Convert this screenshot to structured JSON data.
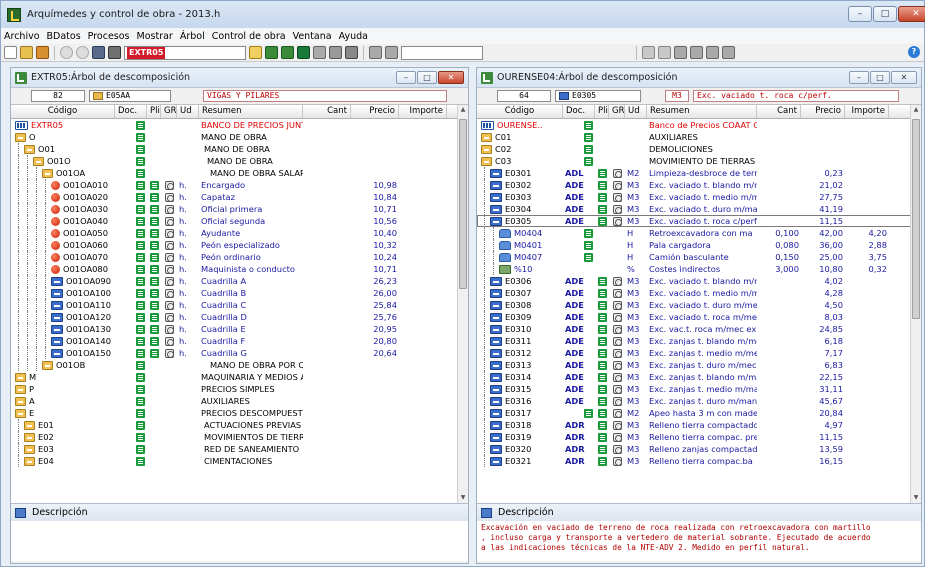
{
  "window": {
    "title": "Arquímedes y control de obra - 2013.h",
    "buttons": [
      "–",
      "□",
      "✕"
    ]
  },
  "menu": [
    "Archivo",
    "BDatos",
    "Procesos",
    "Mostrar",
    "Árbol",
    "Control de obra",
    "Ventana",
    "Ayuda"
  ],
  "toolbar": {
    "active_code": "EXTR05"
  },
  "left_panel": {
    "title": "EXTR05:Árbol de descomposición",
    "count": "82",
    "code": "E05AA",
    "name": "VIGAS Y PILARES",
    "columns": [
      "Código",
      "Doc.",
      "Pli",
      "GR",
      "Ud",
      "Resumen",
      "Cant",
      "Precio",
      "Importe"
    ],
    "rows": [
      {
        "icon": "root",
        "code": "EXTR05",
        "doc": true,
        "summary": "BANCO DE PRECIOS JUNTA",
        "style": "red",
        "indent": 0
      },
      {
        "icon": "chap",
        "code": "O",
        "doc": true,
        "summary": "MANO DE OBRA",
        "indent": 0
      },
      {
        "icon": "chap",
        "code": "O01",
        "doc": true,
        "summary": "MANO DE OBRA",
        "indent": 1
      },
      {
        "icon": "chap",
        "code": "O01O",
        "doc": true,
        "summary": "MANO DE OBRA",
        "indent": 2
      },
      {
        "icon": "chap",
        "code": "O01OA",
        "doc": true,
        "summary": "MANO DE OBRA SALAR",
        "indent": 3
      },
      {
        "icon": "basic",
        "code": "O01OA010",
        "doc": true,
        "pli": true,
        "ud": "h.",
        "summary": "Encargado",
        "price": "10,98",
        "indent": 4
      },
      {
        "icon": "basic",
        "code": "O01OA020",
        "doc": true,
        "pli": true,
        "ud": "h.",
        "summary": "Capataz",
        "price": "10,84",
        "indent": 4
      },
      {
        "icon": "basic",
        "code": "O01OA030",
        "doc": true,
        "pli": true,
        "ud": "h.",
        "summary": "Oficial primera",
        "price": "10,71",
        "indent": 4
      },
      {
        "icon": "basic",
        "code": "O01OA040",
        "doc": true,
        "pli": true,
        "ud": "h.",
        "summary": "Oficial segunda",
        "price": "10,56",
        "indent": 4
      },
      {
        "icon": "basic",
        "code": "O01OA050",
        "doc": true,
        "pli": true,
        "ud": "h.",
        "summary": "Ayudante",
        "price": "10,40",
        "indent": 4
      },
      {
        "icon": "basic",
        "code": "O01OA060",
        "doc": true,
        "pli": true,
        "ud": "h.",
        "summary": "Peón especializado",
        "price": "10,32",
        "indent": 4
      },
      {
        "icon": "basic",
        "code": "O01OA070",
        "doc": true,
        "pli": true,
        "ud": "h.",
        "summary": "Peón ordinario",
        "price": "10,24",
        "indent": 4
      },
      {
        "icon": "basic",
        "code": "O01OA080",
        "doc": true,
        "pli": true,
        "ud": "h.",
        "summary": "Maquinista o conducto",
        "price": "10,71",
        "indent": 4
      },
      {
        "icon": "dec",
        "code": "O01OA090",
        "doc": true,
        "pli": true,
        "ud": "h.",
        "summary": "Cuadrilla A",
        "price": "26,23",
        "indent": 4
      },
      {
        "icon": "dec",
        "code": "O01OA100",
        "doc": true,
        "pli": true,
        "ud": "h.",
        "summary": "Cuadrilla B",
        "price": "26,00",
        "indent": 4
      },
      {
        "icon": "dec",
        "code": "O01OA110",
        "doc": true,
        "pli": true,
        "ud": "h.",
        "summary": "Cuadrilla C",
        "price": "25,84",
        "indent": 4
      },
      {
        "icon": "dec",
        "code": "O01OA120",
        "doc": true,
        "pli": true,
        "ud": "h.",
        "summary": "Cuadrilla D",
        "price": "25,76",
        "indent": 4
      },
      {
        "icon": "dec",
        "code": "O01OA130",
        "doc": true,
        "pli": true,
        "ud": "h.",
        "summary": "Cuadrilla E",
        "price": "20,95",
        "indent": 4
      },
      {
        "icon": "dec",
        "code": "O01OA140",
        "doc": true,
        "pli": true,
        "ud": "h.",
        "summary": "Cuadrilla F",
        "price": "20,80",
        "indent": 4
      },
      {
        "icon": "dec",
        "code": "O01OA150",
        "doc": true,
        "pli": true,
        "ud": "h.",
        "summary": "Cuadrilla G",
        "price": "20,64",
        "indent": 4
      },
      {
        "icon": "chap",
        "code": "O01OB",
        "doc": true,
        "summary": "MANO DE OBRA POR C",
        "indent": 3
      },
      {
        "icon": "chap",
        "code": "M",
        "doc": true,
        "summary": "MAQUINARIA Y MEDIOS AU",
        "indent": 0
      },
      {
        "icon": "chap",
        "code": "P",
        "doc": true,
        "summary": "PRECIOS SIMPLES",
        "indent": 0
      },
      {
        "icon": "chap",
        "code": "A",
        "doc": true,
        "summary": "AUXILIARES",
        "indent": 0
      },
      {
        "icon": "chap",
        "code": "E",
        "doc": true,
        "summary": "PRECIOS DESCOMPUESTO",
        "indent": 0
      },
      {
        "icon": "chap",
        "code": "E01",
        "doc": true,
        "summary": "ACTUACIONES PREVIAS",
        "indent": 1
      },
      {
        "icon": "chap",
        "code": "E02",
        "doc": true,
        "summary": "MOVIMIENTOS DE TIERRA",
        "indent": 1
      },
      {
        "icon": "chap",
        "code": "E03",
        "doc": true,
        "summary": "RED DE SANEAMIENTO",
        "indent": 1
      },
      {
        "icon": "chap",
        "code": "E04",
        "doc": true,
        "summary": "CIMENTACIONES",
        "indent": 1
      }
    ],
    "description_label": "Descripción",
    "description": ""
  },
  "right_panel": {
    "title": "OURENSE04:Árbol de descomposición",
    "count": "64",
    "code": "E0305",
    "unit": "M3",
    "name": "Exc. vaciado t. roca c/perf.",
    "columns": [
      "Código",
      "Doc.",
      "Pli",
      "GR",
      "Ud",
      "Resumen",
      "Cant",
      "Precio",
      "Importe"
    ],
    "rows": [
      {
        "icon": "root",
        "code": "OURENSE..",
        "doc": true,
        "summary": "Banco de Precios COAAT Our",
        "style": "red",
        "indent": 0
      },
      {
        "icon": "chap",
        "code": "C01",
        "doc": true,
        "summary": "AUXILIARES",
        "indent": 0
      },
      {
        "icon": "chap",
        "code": "C02",
        "doc": true,
        "summary": "DEMOLICIONES",
        "indent": 0
      },
      {
        "icon": "chap",
        "code": "C03",
        "doc": true,
        "summary": "MOVIMIENTO DE TIERRAS",
        "indent": 0
      },
      {
        "icon": "dec",
        "code": "E0301",
        "doc_label": "ADL",
        "doc": true,
        "pli": true,
        "ud": "M2",
        "summary": "Limpieza-desbroce de terr",
        "price": "0,23",
        "indent": 1
      },
      {
        "icon": "dec",
        "code": "E0302",
        "doc_label": "ADE",
        "doc": true,
        "pli": true,
        "ud": "M3",
        "summary": "Exc. vaciado t. blando m/m",
        "price": "21,02",
        "indent": 1
      },
      {
        "icon": "dec",
        "code": "E0303",
        "doc_label": "ADE",
        "doc": true,
        "pli": true,
        "ud": "M3",
        "summary": "Exc. vaciado t. medio m/m",
        "price": "27,75",
        "indent": 1
      },
      {
        "icon": "dec",
        "code": "E0304",
        "doc_label": "ADE",
        "doc": true,
        "pli": true,
        "ud": "M3",
        "summary": "Exc. vaciado t. duro m/mar",
        "price": "41,19",
        "indent": 1
      },
      {
        "icon": "dec",
        "code": "E0305",
        "doc_label": "ADE",
        "doc": true,
        "pli": true,
        "ud": "M3",
        "summary": "Exc. vaciado t. roca c/perf.",
        "price": "11,15",
        "indent": 1,
        "selected": true
      },
      {
        "icon": "mach",
        "code": "M0404",
        "doc": true,
        "ud": "H",
        "summary": "Retroexcavadora con ma",
        "qty": "0,100",
        "price": "42,00",
        "amount": "4,20",
        "indent": 2,
        "style": "blue"
      },
      {
        "icon": "mach",
        "code": "M0401",
        "doc": true,
        "ud": "H",
        "summary": "Pala cargadora",
        "qty": "0,080",
        "price": "36,00",
        "amount": "2,88",
        "indent": 2,
        "style": "blue"
      },
      {
        "icon": "mach",
        "code": "M0407",
        "doc": true,
        "ud": "H",
        "summary": "Camión basculante",
        "qty": "0,150",
        "price": "25,00",
        "amount": "3,75",
        "indent": 2,
        "style": "blue"
      },
      {
        "icon": "pct",
        "code": "%10",
        "ud": "%",
        "summary": "Costes indirectos",
        "qty": "3,000",
        "price": "10,80",
        "amount": "0,32",
        "indent": 2,
        "style": "blue"
      },
      {
        "icon": "dec",
        "code": "E0306",
        "doc_label": "ADE",
        "doc": true,
        "pli": true,
        "ud": "M3",
        "summary": "Exc. vaciado t. blando m/m",
        "price": "4,02",
        "indent": 1
      },
      {
        "icon": "dec",
        "code": "E0307",
        "doc_label": "ADE",
        "doc": true,
        "pli": true,
        "ud": "M3",
        "summary": "Exc. vaciado t. medio m/m",
        "price": "4,28",
        "indent": 1
      },
      {
        "icon": "dec",
        "code": "E0308",
        "doc_label": "ADE",
        "doc": true,
        "pli": true,
        "ud": "M3",
        "summary": "Exc. vaciado t. duro m/mec",
        "price": "4,50",
        "indent": 1
      },
      {
        "icon": "dec",
        "code": "E0309",
        "doc_label": "ADE",
        "doc": true,
        "pli": true,
        "ud": "M3",
        "summary": "Exc. vaciado t. roca m/mec",
        "price": "8,03",
        "indent": 1
      },
      {
        "icon": "dec",
        "code": "E0310",
        "doc_label": "ADE",
        "doc": true,
        "pli": true,
        "ud": "M3",
        "summary": "Exc. vac.t. roca m/mec exp",
        "price": "24,85",
        "indent": 1
      },
      {
        "icon": "dec",
        "code": "E0311",
        "doc_label": "ADE",
        "doc": true,
        "pli": true,
        "ud": "M3",
        "summary": "Exc. zanjas t. blando m/me",
        "price": "6,18",
        "indent": 1
      },
      {
        "icon": "dec",
        "code": "E0312",
        "doc_label": "ADE",
        "doc": true,
        "pli": true,
        "ud": "M3",
        "summary": "Exc. zanjas t. medio m/me",
        "price": "7,17",
        "indent": 1
      },
      {
        "icon": "dec",
        "code": "E0313",
        "doc_label": "ADE",
        "doc": true,
        "pli": true,
        "ud": "M3",
        "summary": "Exc. zanjas t. duro m/mec",
        "price": "6,83",
        "indent": 1
      },
      {
        "icon": "dec",
        "code": "E0314",
        "doc_label": "ADE",
        "doc": true,
        "pli": true,
        "ud": "M3",
        "summary": "Exc. zanjas t. blando m/ma",
        "price": "22,15",
        "indent": 1
      },
      {
        "icon": "dec",
        "code": "E0315",
        "doc_label": "ADE",
        "doc": true,
        "pli": true,
        "ud": "M3",
        "summary": "Exc. zanjas t. medio m/ma",
        "price": "31,11",
        "indent": 1
      },
      {
        "icon": "dec",
        "code": "E0316",
        "doc_label": "ADE",
        "doc": true,
        "pli": true,
        "ud": "M3",
        "summary": "Exc. zanjas t. duro m/man",
        "price": "45,67",
        "indent": 1
      },
      {
        "icon": "dec",
        "code": "E0317",
        "doc": true,
        "pli": true,
        "ud": "M2",
        "summary": "Apeo hasta 3 m con made",
        "price": "20,84",
        "indent": 1
      },
      {
        "icon": "dec",
        "code": "E0318",
        "doc_label": "ADR",
        "doc": true,
        "pli": true,
        "ud": "M3",
        "summary": "Relleno tierra compactado",
        "price": "4,97",
        "indent": 1
      },
      {
        "icon": "dec",
        "code": "E0319",
        "doc_label": "ADR",
        "doc": true,
        "pli": true,
        "ud": "M3",
        "summary": "Relleno tierra compac. pre",
        "price": "11,15",
        "indent": 1
      },
      {
        "icon": "dec",
        "code": "E0320",
        "doc_label": "ADR",
        "doc": true,
        "pli": true,
        "ud": "M3",
        "summary": "Relleno zanjas compactad",
        "price": "13,59",
        "indent": 1
      },
      {
        "icon": "dec",
        "code": "E0321",
        "doc_label": "ADR",
        "doc": true,
        "pli": true,
        "ud": "M3",
        "summary": "Relleno tierra compac.ba",
        "price": "16,15",
        "indent": 1
      }
    ],
    "description_label": "Descripción",
    "description": "Excavación en vaciado de terreno de roca realizada con retroexcavadora con martillo\n, incluso carga y transporte a vertedero de material sobrante. Ejecutado de acuerdo\na las indicaciones técnicas de la NTE-ADV 2. Medido en perfil natural."
  },
  "colors": {
    "red_text": "#e00000",
    "blue_text": "#1a1aa0",
    "doc_green": "#1a9a3a",
    "chapter_folder": "#f0c050"
  }
}
